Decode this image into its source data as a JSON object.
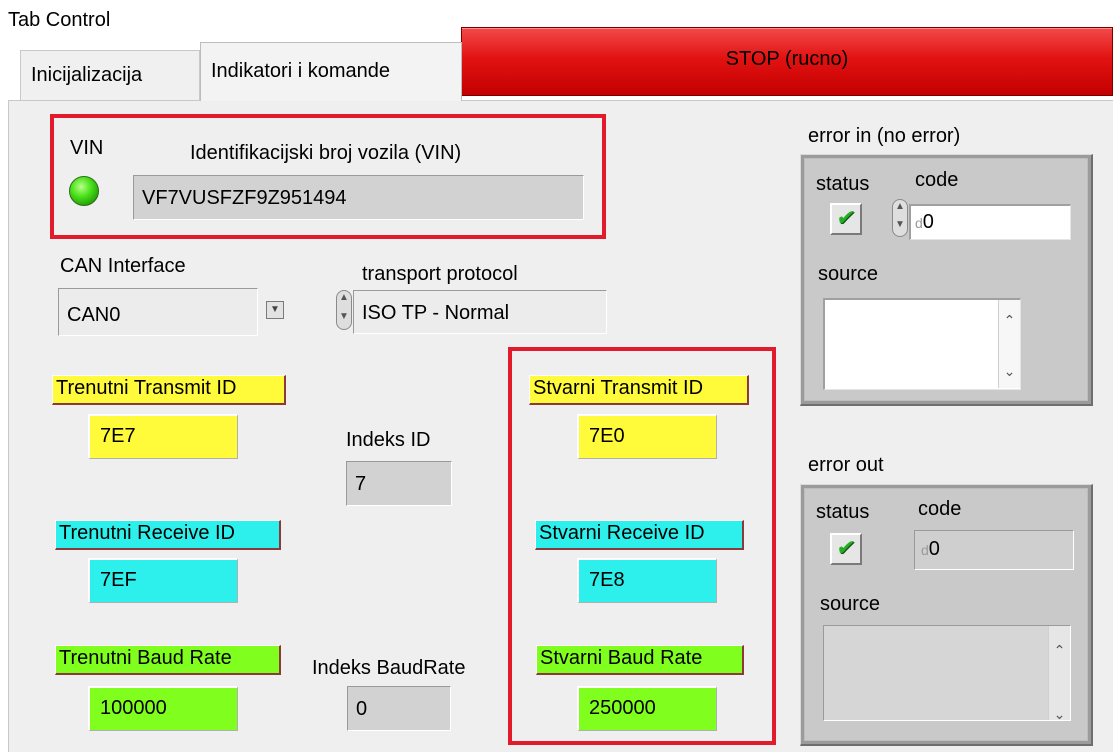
{
  "window": {
    "title": "Tab Control"
  },
  "tabs": [
    {
      "label": "Inicijalizacija",
      "active": false
    },
    {
      "label": "Indikatori i komande",
      "active": true
    }
  ],
  "stop_button": {
    "label": "STOP (rucno)"
  },
  "vin": {
    "led_label": "VIN",
    "field_label": "Identifikacijski broj vozila (VIN)",
    "value": "VF7VUSFZF9Z951494"
  },
  "can_interface": {
    "label": "CAN Interface",
    "value": "CAN0"
  },
  "transport_protocol": {
    "label": "transport protocol",
    "value": "ISO TP - Normal"
  },
  "trenutni": {
    "transmit_label": "Trenutni Transmit ID",
    "transmit_value": "7E7",
    "receive_label": "Trenutni Receive ID",
    "receive_value": "7EF",
    "baud_label": "Trenutni Baud Rate",
    "baud_value": "100000"
  },
  "indeks_id": {
    "label": "Indeks ID",
    "value": "7"
  },
  "indeks_baud": {
    "label": "Indeks BaudRate",
    "value": "0"
  },
  "stvarni": {
    "transmit_label": "Stvarni Transmit ID",
    "transmit_value": "7E0",
    "receive_label": "Stvarni Receive ID",
    "receive_value": "7E8",
    "baud_label": "Stvarni Baud Rate",
    "baud_value": "250000"
  },
  "error_in": {
    "title": "error in (no error)",
    "status_label": "status",
    "code_label": "code",
    "code_value": "0",
    "source_label": "source",
    "d_tag": "d"
  },
  "error_out": {
    "title": "error out",
    "status_label": "status",
    "code_label": "code",
    "code_value": "0",
    "source_label": "source",
    "d_tag": "d"
  },
  "colors": {
    "stop": "#e21212",
    "highlight": "#e11b2c",
    "yellow": "#fffb3a",
    "cyan": "#2df0ec",
    "green": "#80ff1e"
  }
}
